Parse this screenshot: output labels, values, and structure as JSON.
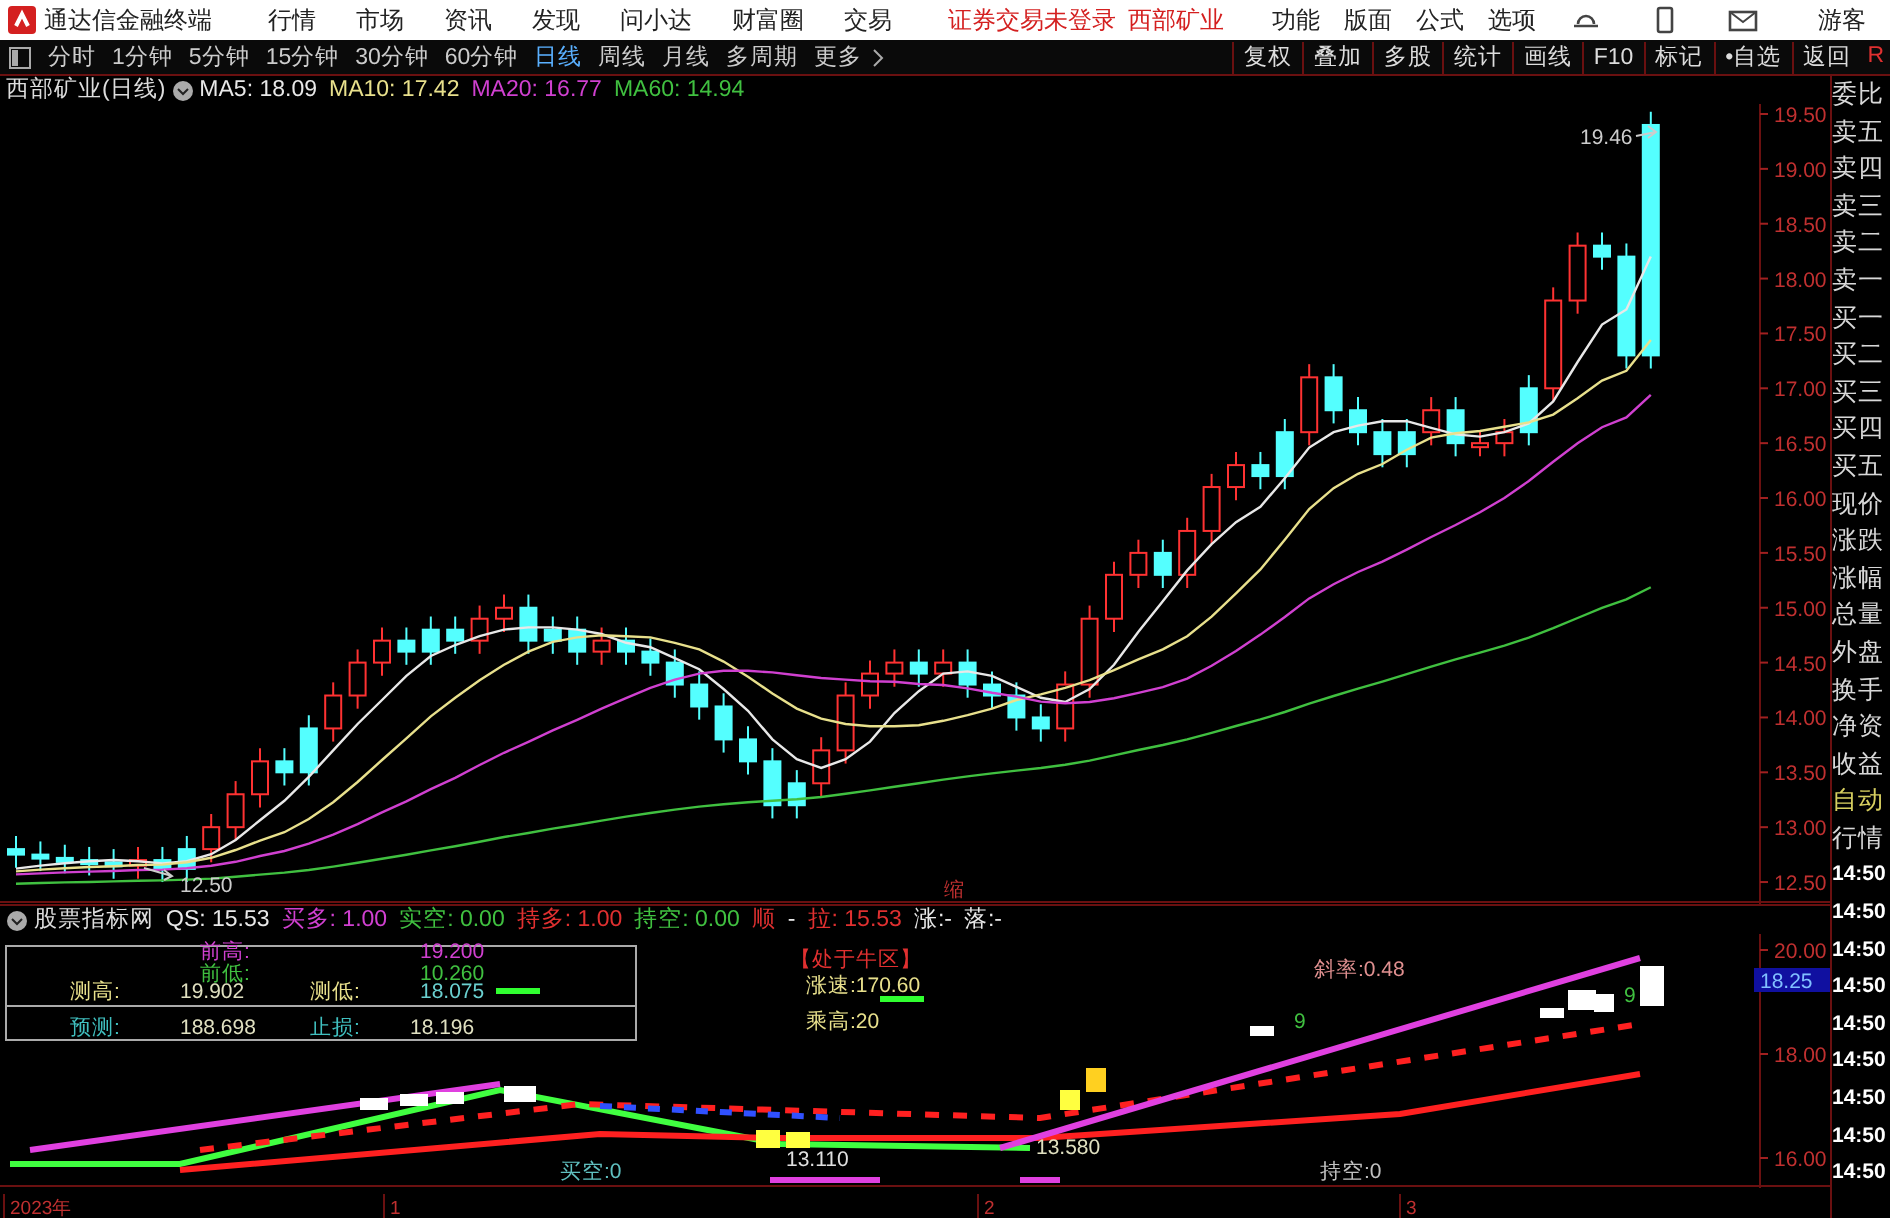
{
  "app": {
    "title": "通达信金融终端"
  },
  "menu": [
    "行情",
    "市场",
    "资讯",
    "发现",
    "问小达",
    "财富圈",
    "交易"
  ],
  "notice": "证券交易未登录",
  "stock_link": "西部矿业",
  "right_menu": [
    "功能",
    "版面",
    "公式",
    "选项"
  ],
  "user": "游客",
  "periods": [
    {
      "label": "分时",
      "selected": false
    },
    {
      "label": "1分钟",
      "selected": false
    },
    {
      "label": "5分钟",
      "selected": false
    },
    {
      "label": "15分钟",
      "selected": false
    },
    {
      "label": "30分钟",
      "selected": false
    },
    {
      "label": "60分钟",
      "selected": false
    },
    {
      "label": "日线",
      "selected": true
    },
    {
      "label": "周线",
      "selected": false
    },
    {
      "label": "月线",
      "selected": false
    },
    {
      "label": "多周期",
      "selected": false
    },
    {
      "label": "更多",
      "selected": false
    }
  ],
  "tools": [
    "复权",
    "叠加",
    "多股",
    "统计",
    "画线",
    "F10",
    "标记",
    "•自选",
    "返回"
  ],
  "corner_mark": "R",
  "chart": {
    "title": "西部矿业(日线)",
    "ma": [
      {
        "label": "MA5: 18.09",
        "color": "#e8e8e8"
      },
      {
        "label": "MA10: 17.42",
        "color": "#e8e08c"
      },
      {
        "label": "MA20: 16.77",
        "color": "#d040d0"
      },
      {
        "label": "MA60: 14.94",
        "color": "#40c040"
      }
    ],
    "yticks": [
      "19.50",
      "19.00",
      "18.50",
      "18.00",
      "17.50",
      "17.00",
      "16.50",
      "16.00",
      "15.50",
      "15.00",
      "14.50",
      "14.00",
      "13.50",
      "13.00",
      "12.50"
    ],
    "high_label": "19.46",
    "low_label": "12.50",
    "volume_tag": "缩"
  },
  "indicator": {
    "name": "股票指标网",
    "readouts": [
      {
        "text": "QS: 15.53",
        "color": "#e8e8e8"
      },
      {
        "text": "买多: 1.00",
        "color": "#d040d0"
      },
      {
        "text": "实空: 0.00",
        "color": "#40c040"
      },
      {
        "text": "持多: 1.00",
        "color": "#e03030"
      },
      {
        "text": "持空: 0.00",
        "color": "#40c040"
      },
      {
        "text": "顺",
        "color": "#e03030"
      },
      {
        "text": "-",
        "color": "#e8e8e8"
      },
      {
        "text": "拉: 15.53",
        "color": "#e03030"
      },
      {
        "text": "涨:-",
        "color": "#e8e8e8"
      },
      {
        "text": "落:-",
        "color": "#e8e8e8"
      }
    ],
    "table": [
      {
        "label": "前高:",
        "value": "19.200",
        "color": "#d040d0"
      },
      {
        "label": "前低:",
        "value": "10.260",
        "color": "#40c040"
      },
      {
        "label": "测高:",
        "value": "19.902",
        "color": "#e8e08c"
      },
      {
        "label": "测低:",
        "value": "18.075",
        "color": "#e8e08c"
      },
      {
        "label": "预测:",
        "value": "188.698",
        "color": "#40c0c0"
      },
      {
        "label": "止损:",
        "value": "18.196",
        "color": "#40c0c0"
      }
    ],
    "status": "【处于牛区】",
    "speed": "涨速:170.60",
    "ratio": "乘高:20",
    "slope": "斜率:0.48",
    "marks": [
      "9",
      "9",
      "13.110",
      "13.580",
      "买空:0",
      "持空:0"
    ],
    "yticks": [
      "20.00",
      "18.00",
      "16.00"
    ],
    "current": "18.25"
  },
  "xaxis": [
    "2023年",
    "1",
    "2",
    "3"
  ],
  "sidebar": [
    {
      "label": "委比",
      "kind": "field"
    },
    {
      "label": "卖五",
      "kind": "field"
    },
    {
      "label": "卖四",
      "kind": "field"
    },
    {
      "label": "卖三",
      "kind": "field"
    },
    {
      "label": "卖二",
      "kind": "field"
    },
    {
      "label": "卖一",
      "kind": "field"
    },
    {
      "label": "买一",
      "kind": "field"
    },
    {
      "label": "买二",
      "kind": "field"
    },
    {
      "label": "买三",
      "kind": "field"
    },
    {
      "label": "买四",
      "kind": "field"
    },
    {
      "label": "买五",
      "kind": "field"
    },
    {
      "label": "现价",
      "kind": "field"
    },
    {
      "label": "涨跌",
      "kind": "field"
    },
    {
      "label": "涨幅",
      "kind": "field"
    },
    {
      "label": "总量",
      "kind": "field"
    },
    {
      "label": "外盘",
      "kind": "field"
    },
    {
      "label": "换手",
      "kind": "field"
    },
    {
      "label": "净资",
      "kind": "field"
    },
    {
      "label": "收益",
      "kind": "field"
    },
    {
      "label": "自动",
      "kind": "mode"
    },
    {
      "label": "行情",
      "kind": "field"
    },
    {
      "label": "14:50",
      "kind": "time"
    },
    {
      "label": "14:50",
      "kind": "time"
    },
    {
      "label": "14:50",
      "kind": "time"
    },
    {
      "label": "14:50",
      "kind": "time"
    },
    {
      "label": "14:50",
      "kind": "time"
    },
    {
      "label": "14:50",
      "kind": "time"
    },
    {
      "label": "14:50",
      "kind": "time"
    },
    {
      "label": "14:50",
      "kind": "time"
    },
    {
      "label": "14:50",
      "kind": "time"
    }
  ]
}
